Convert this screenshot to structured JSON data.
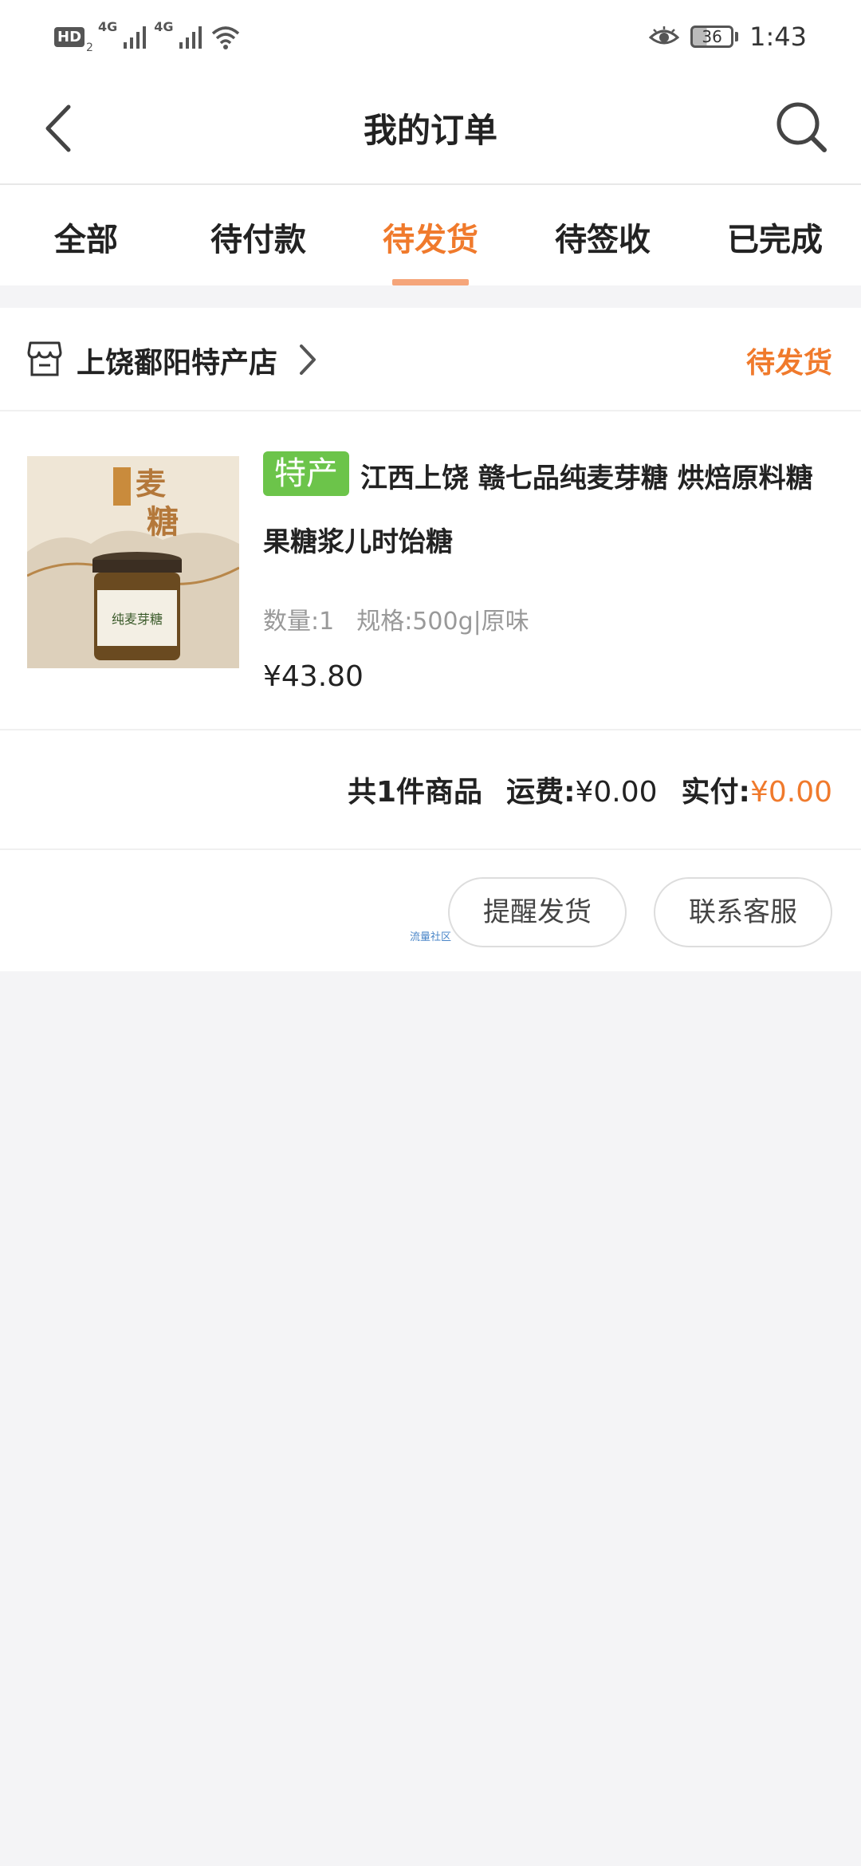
{
  "status_bar": {
    "hd": "HD",
    "sim": "2",
    "net1": "4G",
    "net2": "4G",
    "battery": "36",
    "time": "1:43",
    "icons": [
      "signal-icon",
      "wifi-icon",
      "eye-icon",
      "battery-icon"
    ]
  },
  "header": {
    "title": "我的订单",
    "back_icon": "chevron-left-icon",
    "search_icon": "search-icon"
  },
  "tabs": [
    {
      "label": "全部",
      "active": false
    },
    {
      "label": "待付款",
      "active": false
    },
    {
      "label": "待发货",
      "active": true
    },
    {
      "label": "待签收",
      "active": false
    },
    {
      "label": "已完成",
      "active": false
    }
  ],
  "order": {
    "shop_name": "上饶鄱阳特产店",
    "status": "待发货",
    "product": {
      "tag": "特产",
      "title": "江西上饶   赣七品纯麦芽糖  烘焙原料糖果糖浆儿时饴糖",
      "quantity": "数量:1",
      "spec": "规格:500g|原味",
      "price": "¥43.80",
      "image_label": "纯麦芽糖"
    },
    "summary": {
      "count": "共1件商品",
      "shipping_label": "运费:",
      "shipping_value": "¥0.00",
      "paid_label": "实付:",
      "paid_value": "¥0.00"
    },
    "actions": {
      "remind": "提醒发货",
      "service": "联系客服"
    },
    "watermark": "流量社区"
  },
  "colors": {
    "accent": "#f07a2c",
    "tag_green": "#6cc44a",
    "background": "#f4f4f6"
  }
}
